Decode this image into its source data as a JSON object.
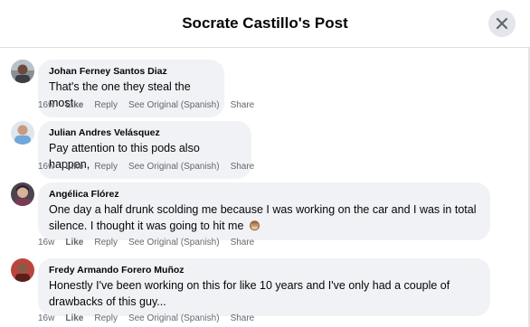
{
  "header": {
    "title": "Socrate Castillo's Post"
  },
  "comments": [
    {
      "author": "Johan Ferney Santos Diaz",
      "text": "That's the one they steal the most",
      "time": "16w",
      "like": "Like",
      "reply": "Reply",
      "see_original": "See Original (Spanish)",
      "share": "Share"
    },
    {
      "author": "Julian Andres Velásquez",
      "text": "Pay attention to this pods also happen,",
      "time": "16w",
      "like": "Like",
      "reply": "Reply",
      "see_original": "See Original (Spanish)",
      "share": "Share"
    },
    {
      "author": "Angélica Flórez",
      "text_line1": "One day a half drunk scolding me because I was working on the car and I was in total",
      "text_line2": "silence. I thought it was going to hit me",
      "emoji": "see-no-evil-monkey-emoji",
      "time": "16w",
      "like": "Like",
      "reply": "Reply",
      "see_original": "See Original (Spanish)",
      "share": "Share"
    },
    {
      "author": "Fredy Armando Forero Muñoz",
      "text_line1": "Honestly I've been working on this for like 10 years and I've only had a couple of",
      "text_line2": "drawbacks of this guy...",
      "time": "16w",
      "like": "Like",
      "reply": "Reply",
      "see_original": "See Original (Spanish)",
      "share": "Share"
    }
  ]
}
